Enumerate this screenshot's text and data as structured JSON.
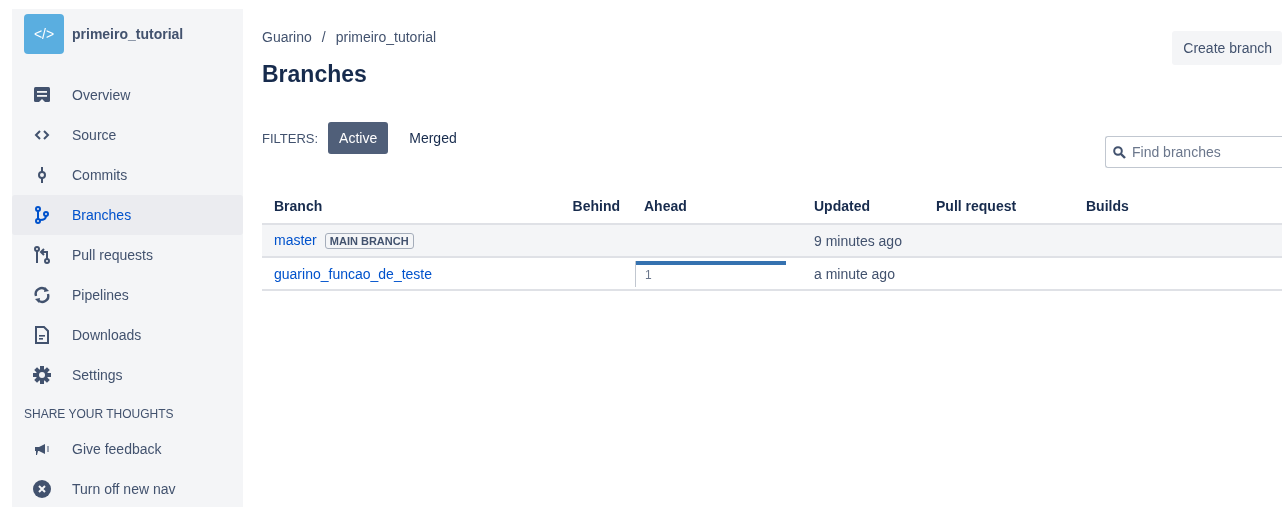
{
  "repo": {
    "name": "primeiro_tutorial",
    "logo": "</>"
  },
  "sidebar": {
    "items": [
      {
        "label": "Overview",
        "kind": "overview",
        "selected": false
      },
      {
        "label": "Source",
        "kind": "source",
        "selected": false
      },
      {
        "label": "Commits",
        "kind": "commits",
        "selected": false
      },
      {
        "label": "Branches",
        "kind": "branches",
        "selected": true
      },
      {
        "label": "Pull requests",
        "kind": "pulls",
        "selected": false
      },
      {
        "label": "Pipelines",
        "kind": "pipelines",
        "selected": false
      },
      {
        "label": "Downloads",
        "kind": "downloads",
        "selected": false
      },
      {
        "label": "Settings",
        "kind": "settings",
        "selected": false
      }
    ],
    "section_title": "SHARE YOUR THOUGHTS",
    "extra_items": [
      {
        "label": "Give feedback",
        "kind": "feedback"
      },
      {
        "label": "Turn off new nav",
        "kind": "close"
      }
    ]
  },
  "breadcrumbs": [
    "Guarino",
    "primeiro_tutorial"
  ],
  "breadcrumb_separator": "/",
  "title": "Branches",
  "create_button": "Create branch",
  "filters": {
    "label": "FILTERS:",
    "options": [
      {
        "label": "Active",
        "selected": true
      },
      {
        "label": "Merged",
        "selected": false
      }
    ]
  },
  "search": {
    "placeholder": "Find branches"
  },
  "table": {
    "columns": [
      "Branch",
      "Behind",
      "Ahead",
      "Updated",
      "Pull request",
      "Builds"
    ],
    "rows": [
      {
        "branch": "master",
        "badge": "MAIN BRANCH",
        "updated": "9 minutes ago"
      },
      {
        "branch": "guarino_funcao_de_teste",
        "ahead": {
          "count": "1",
          "level": 1
        },
        "updated": "a minute ago"
      }
    ]
  }
}
